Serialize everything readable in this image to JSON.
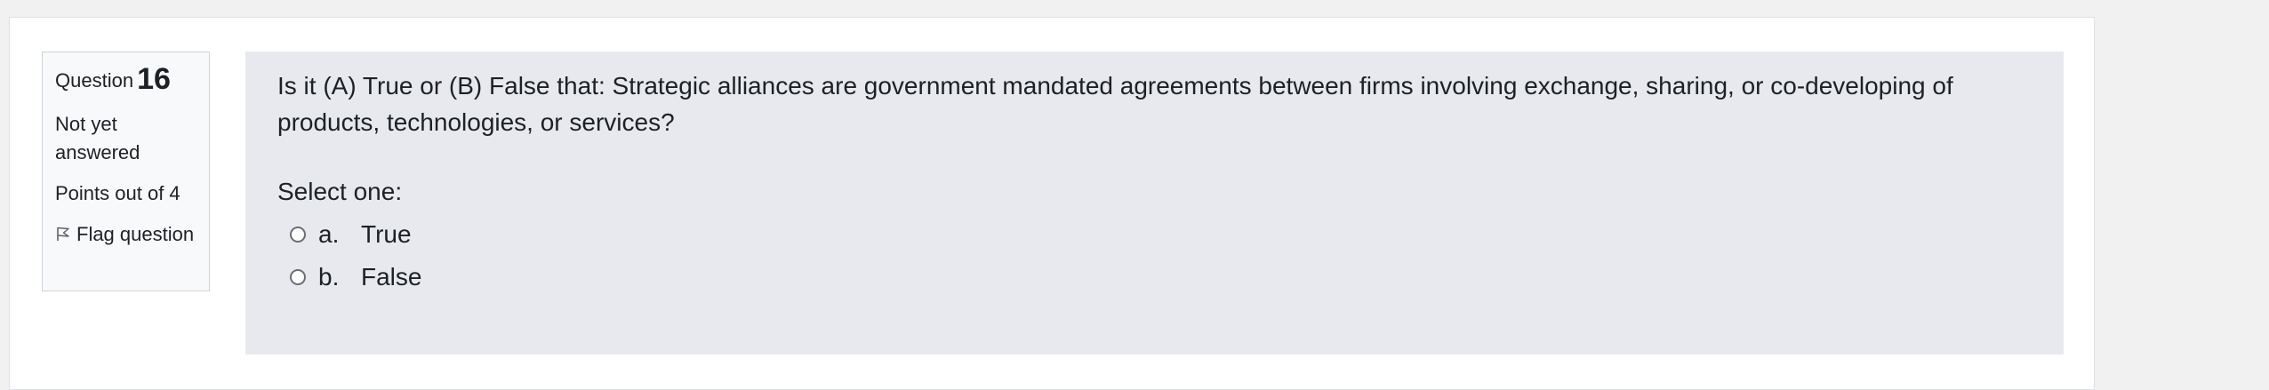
{
  "question": {
    "label": "Question",
    "number": "16",
    "state": "Not yet answered",
    "grade": "Points out of 4",
    "flag_label": "Flag question"
  },
  "content": {
    "text": "Is it (A) True or (B) False that: Strategic alliances are government mandated agreements between firms involving exchange, sharing, or co-developing of products, technologies, or services?",
    "prompt": "Select one:",
    "options": [
      {
        "letter": "a.",
        "text": "True"
      },
      {
        "letter": "b.",
        "text": "False"
      }
    ]
  },
  "colors": {
    "page_background": "#f1f1f1",
    "info_background": "#f8f9fa",
    "content_background": "#e7e9ee"
  }
}
